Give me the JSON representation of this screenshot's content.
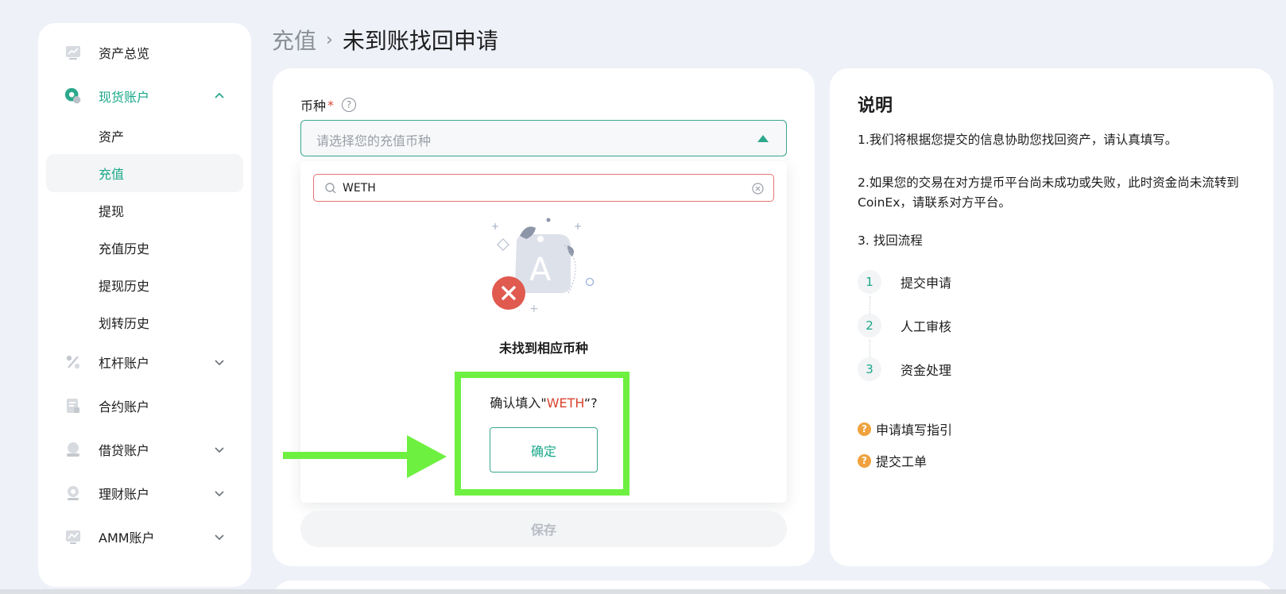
{
  "sidebar": {
    "items": [
      {
        "label": "资产总览",
        "icon": "chart-card-icon"
      },
      {
        "label": "现货账户",
        "icon": "spot-coins-icon",
        "expanded": true
      },
      {
        "label": "杠杆账户",
        "icon": "percent-icon"
      },
      {
        "label": "合约账户",
        "icon": "contract-doc-icon"
      },
      {
        "label": "借贷账户",
        "icon": "loan-coins-icon"
      },
      {
        "label": "理财账户",
        "icon": "finance-coins-icon"
      },
      {
        "label": "AMM账户",
        "icon": "amm-chart-icon"
      }
    ],
    "spot_sub": [
      "资产",
      "充值",
      "提现",
      "充值历史",
      "提现历史",
      "划转历史"
    ],
    "selected_sub": "充值"
  },
  "breadcrumb": {
    "parent": "充值",
    "separator": "›",
    "current": "未到账找回申请"
  },
  "form": {
    "coin_label": "币种",
    "required_mark": "*",
    "help_glyph": "?",
    "select_placeholder": "请选择您的充值币种",
    "search_value": "WETH",
    "empty_text": "未找到相应币种",
    "confirm_prefix": "确认填入\"",
    "confirm_keyword": "WETH",
    "confirm_suffix": "“?",
    "confirm_button": "确定",
    "save_button": "保存"
  },
  "info": {
    "title": "说明",
    "p1": "1.我们将根据您提交的信息协助您找回资产，请认真填写。",
    "p2": "2.如果您的交易在对方提币平台尚未成功或失败，此时资金尚未流转到CoinEx，请联系对方平台。",
    "p3": "3. 找回流程",
    "steps": [
      {
        "num": "1",
        "label": "提交申请"
      },
      {
        "num": "2",
        "label": "人工审核"
      },
      {
        "num": "3",
        "label": "资金处理"
      }
    ],
    "links": [
      {
        "glyph": "?",
        "label": "申请填写指引"
      },
      {
        "glyph": "?",
        "label": "提交工单"
      }
    ]
  },
  "colors": {
    "accent": "#1aa88a",
    "highlight": "#6ef041",
    "error": "#d8432e",
    "background": "#eef1f7"
  }
}
